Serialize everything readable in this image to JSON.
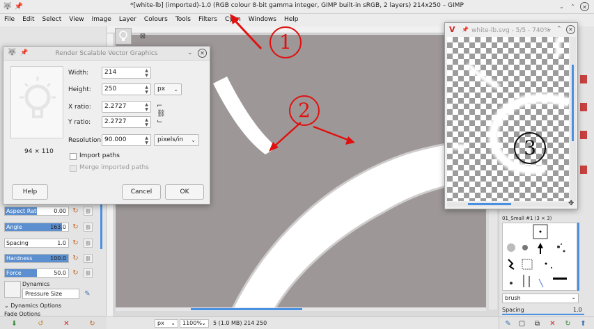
{
  "window": {
    "title": "*[white-lb] (imported)-1.0 (RGB colour 8-bit gamma integer, GIMP built-in sRGB, 2 layers) 214x250 – GIMP"
  },
  "menu": [
    "File",
    "Edit",
    "Select",
    "View",
    "Image",
    "Layer",
    "Colours",
    "Tools",
    "Filters",
    "Cyan",
    "Windows",
    "Help"
  ],
  "dialog": {
    "title": "Render Scalable Vector Graphics",
    "preview_size": "94 × 110",
    "width_label": "Width:",
    "width_value": "214",
    "height_label": "Height:",
    "height_value": "250",
    "unit": "px",
    "x_ratio_label": "X ratio:",
    "x_ratio_value": "2.2727",
    "y_ratio_label": "Y ratio:",
    "y_ratio_value": "2.2727",
    "resolution_label": "Resolution:",
    "resolution_value": "90.000",
    "resolution_unit": "pixels/in",
    "import_paths": "Import paths",
    "merge_paths": "Merge imported paths",
    "help": "Help",
    "cancel": "Cancel",
    "ok": "OK"
  },
  "svg_window": {
    "title": "white-lb.svg - 5/5 - 740%"
  },
  "tool_options": {
    "aspect_ratio": {
      "label": "Aspect Ratio",
      "value": "0.00",
      "fraction": 0.5
    },
    "angle": {
      "label": "Angle",
      "value": "163.0",
      "fraction": 0.9
    },
    "spacing": {
      "label": "Spacing",
      "value": "1.0",
      "fraction": 0.0
    },
    "hardness": {
      "label": "Hardness",
      "value": "100.0",
      "fraction": 1.0
    },
    "force": {
      "label": "Force",
      "value": "50.0",
      "fraction": 0.5
    },
    "dynamics_label": "Dynamics",
    "dynamics_value": "Pressure Size",
    "dynamics_options": "Dynamics Options",
    "fade_options": "Fade Options"
  },
  "status": {
    "unit": "px",
    "zoom": "1100%",
    "info": "5 (1.0 MB) 214 250"
  },
  "brushes": {
    "name": "01_Small #1 (3 × 3)",
    "filter": "brush",
    "spacing_label": "Spacing",
    "spacing_value": "1.0"
  },
  "annotations": [
    "1",
    "2",
    "3"
  ],
  "colors": {
    "canvas_gray": "#9d9897",
    "accent": "#5b8fd0",
    "annotation_red": "#e01010"
  }
}
